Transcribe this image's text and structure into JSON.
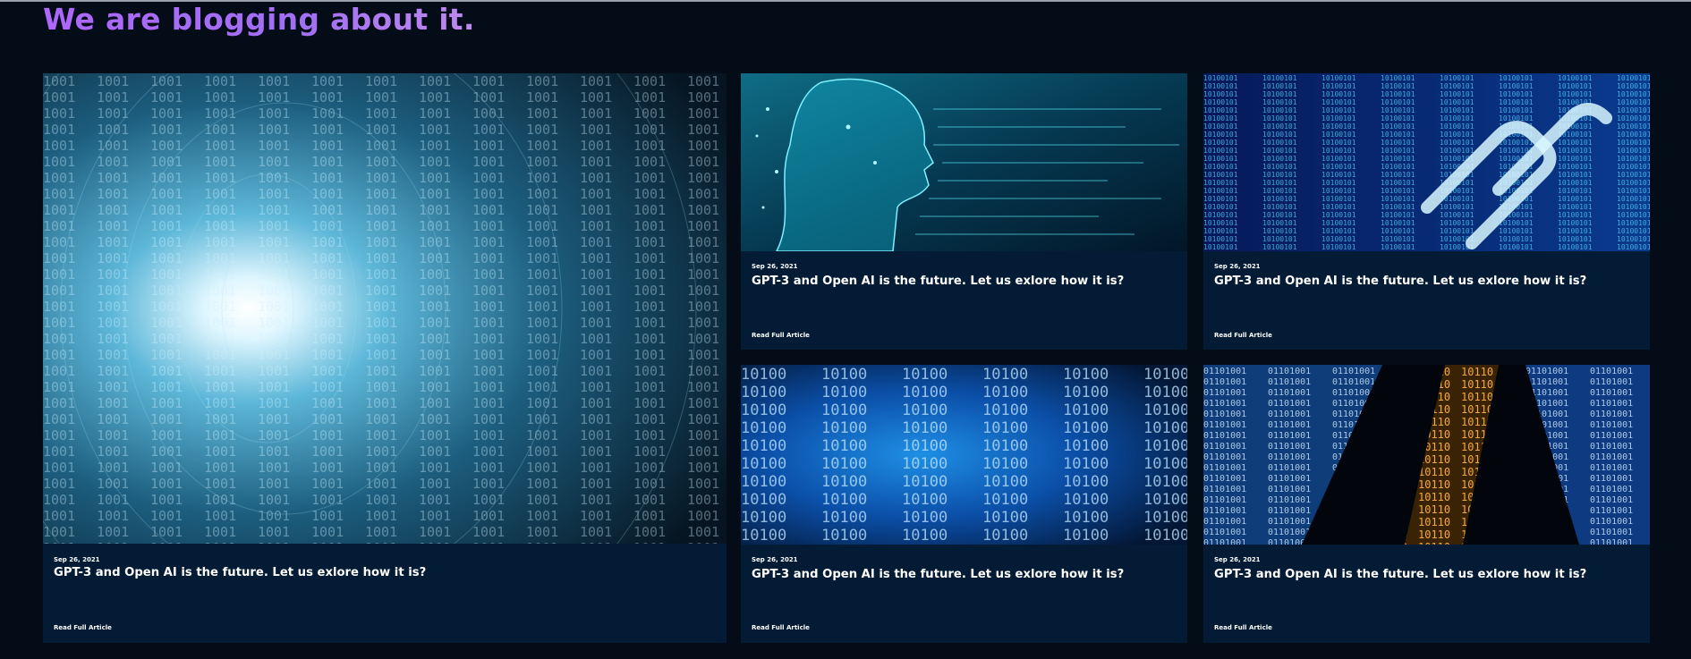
{
  "section": {
    "heading": "We are blogging about it."
  },
  "colors": {
    "background": "#040c18",
    "card": "#031b34",
    "heading_gradient_start": "#ae67fa",
    "heading_gradient_end": "#c089ee",
    "text": "#ffffff"
  },
  "posts": [
    {
      "date": "Sep 26, 2021",
      "title": "GPT-3 and Open AI is the future. Let us exlore how it is?",
      "link_label": "Read Full Article",
      "image": "binary-tunnel-image"
    },
    {
      "date": "Sep 26, 2021",
      "title": "GPT-3 and Open AI is the future. Let us exlore how it is?",
      "link_label": "Read Full Article",
      "image": "ai-circuit-head-image"
    },
    {
      "date": "Sep 26, 2021",
      "title": "GPT-3 and Open AI is the future. Let us exlore how it is?",
      "link_label": "Read Full Article",
      "image": "binary-chain-link-image"
    },
    {
      "date": "Sep 26, 2021",
      "title": "GPT-3 and Open AI is the future. Let us exlore how it is?",
      "link_label": "Read Full Article",
      "image": "blue-binary-grid-image"
    },
    {
      "date": "Sep 26, 2021",
      "title": "GPT-3 and Open AI is the future. Let us exlore how it is?",
      "link_label": "Read Full Article",
      "image": "binary-stream-highlight-image"
    }
  ]
}
